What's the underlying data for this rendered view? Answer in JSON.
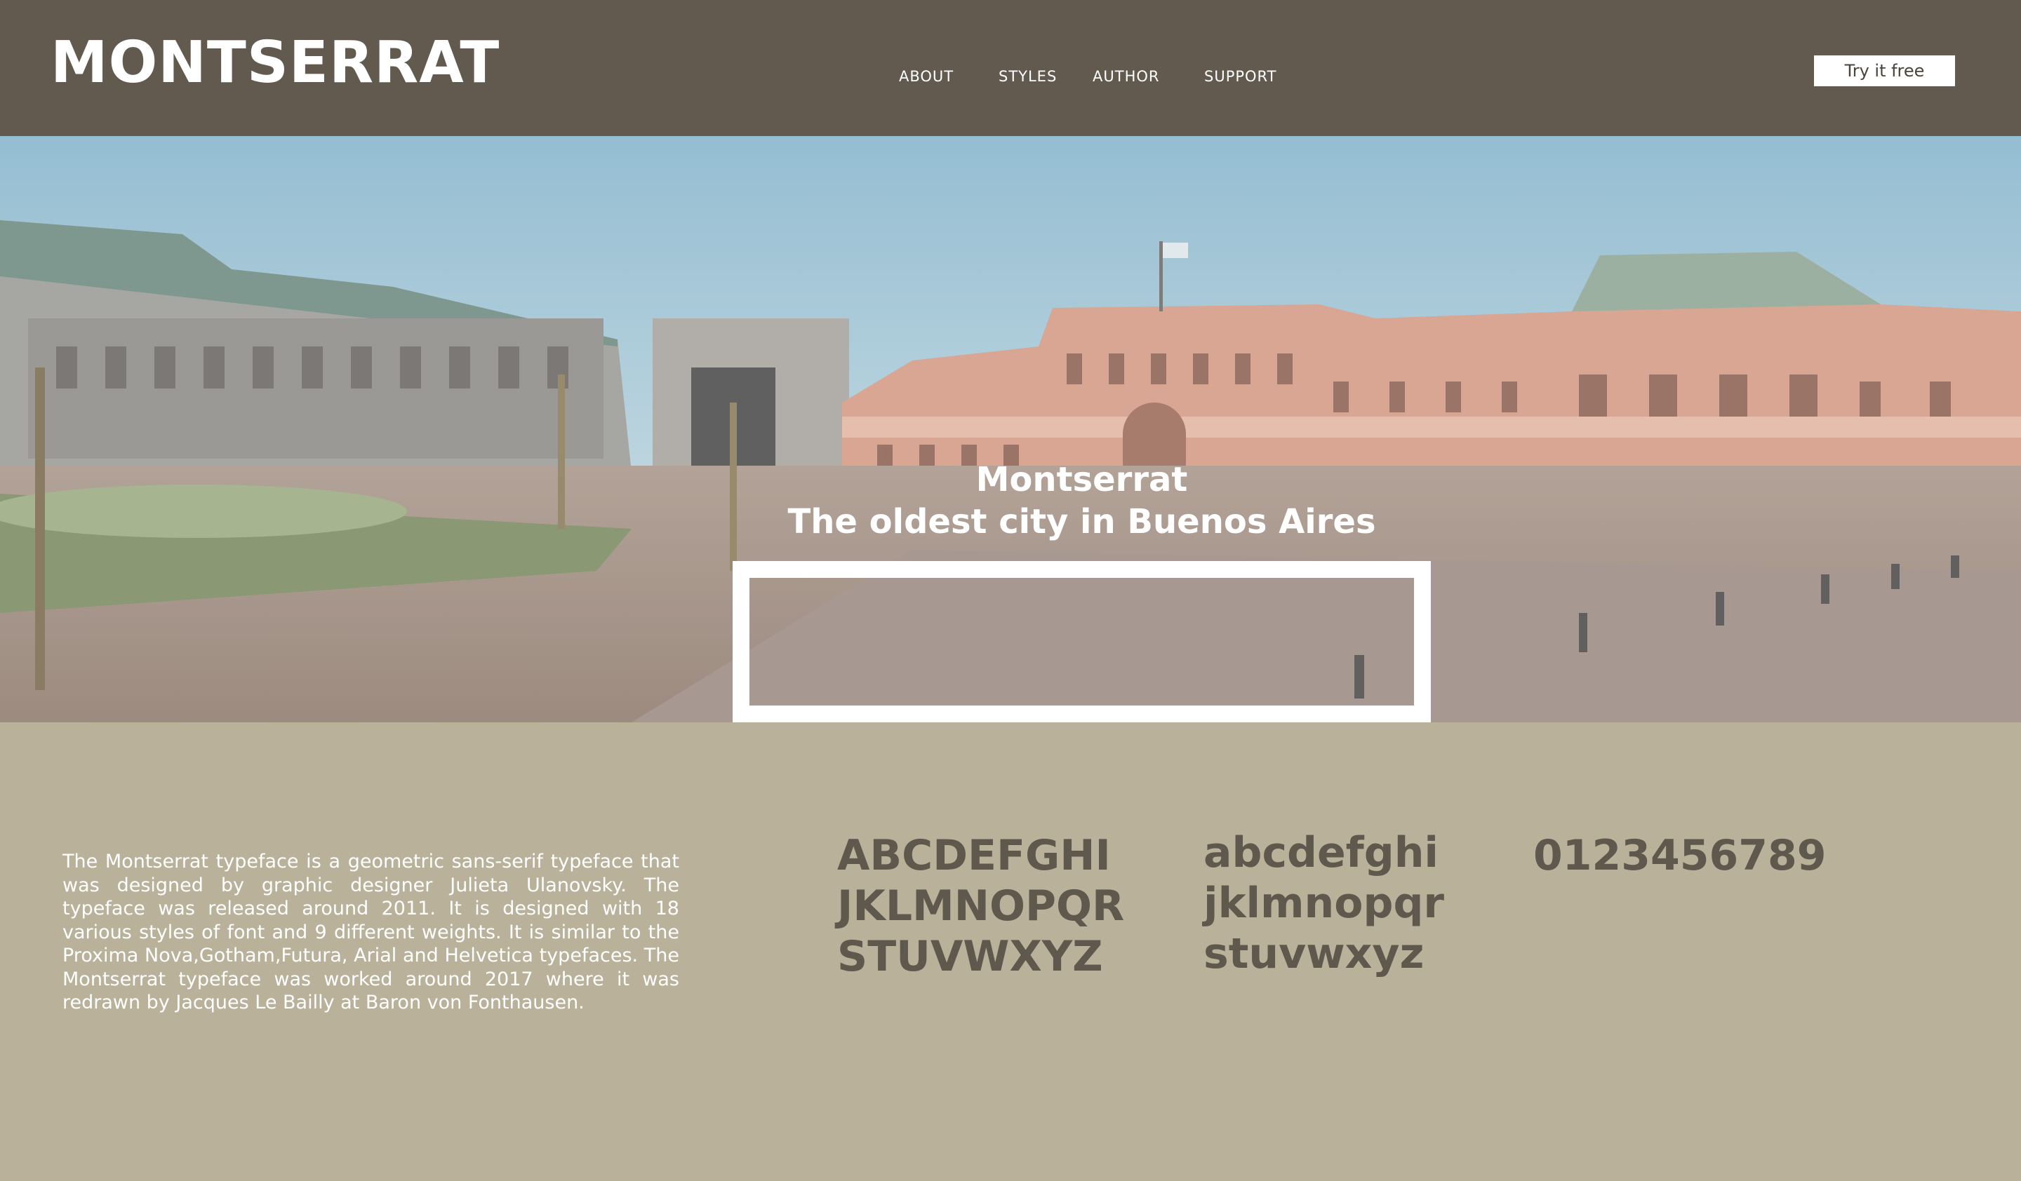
{
  "header": {
    "brand": "MONTSERRAT",
    "nav": [
      {
        "label": "ABOUT"
      },
      {
        "label": "STYLES"
      },
      {
        "label": "AUTHOR"
      },
      {
        "label": "SUPPORT"
      }
    ],
    "cta_label": "Try it free"
  },
  "hero": {
    "caption_title": "Montserrat",
    "caption_subtitle": "The oldest city in Buenos Aires"
  },
  "content": {
    "description": "The Montserrat typeface is a geometric sans-serif typeface that was designed by graphic designer Julieta Ulanovsky. The typeface was released around 2011. It is designed with 18 various styles of font and 9 different weights. It is similar to the Proxima Nova,Gotham,Futura, Arial and Helvetica typefaces. The Montserrat typeface was worked around 2017 where it was redrawn by Jacques Le Bailly at Baron von Fonthausen.",
    "uppercase": [
      "ABCDEFGHI",
      "JKLMNOPQR",
      "STUVWXYZ"
    ],
    "lowercase": [
      "abcdefghi",
      "jklmnopqr",
      "stuvwxyz"
    ],
    "digits": "0123456789"
  },
  "colors": {
    "header_bg": "#625a4f",
    "page_bg": "#b9b19a",
    "glyph_text": "#5f584d",
    "white": "#ffffff"
  }
}
